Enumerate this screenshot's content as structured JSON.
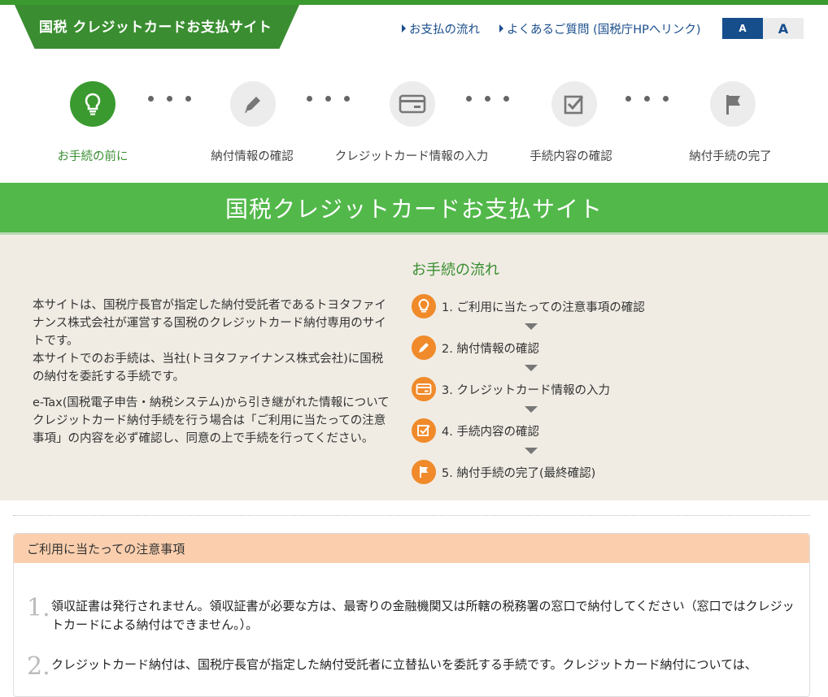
{
  "header": {
    "logo_text": "国税 クレジットカードお支払サイト",
    "links": [
      "お支払の流れ",
      "よくあるご質問 (国税庁HPへリンク)"
    ],
    "font_small": "A",
    "font_large": "A"
  },
  "steps": [
    {
      "label": "お手続の前に",
      "icon": "lightbulb-icon",
      "active": true
    },
    {
      "label": "納付情報の確認",
      "icon": "pencil-icon",
      "active": false
    },
    {
      "label": "クレジットカード情報の入力",
      "icon": "credit-card-icon",
      "active": false
    },
    {
      "label": "手続内容の確認",
      "icon": "checkbox-icon",
      "active": false
    },
    {
      "label": "納付手続の完了",
      "icon": "flag-icon",
      "active": false
    }
  ],
  "banner_title": "国税クレジットカードお支払サイト",
  "intro": {
    "paragraph1_line1": "本サイトは、国税庁長官が指定した納付受託者であるトヨタファイナンス株式会社が運営する国税のクレジットカード納付専用のサイトです。",
    "paragraph1_line2": "本サイトでのお手続は、当社(トヨタファイナンス株式会社)に国税の納付を委託する手続です。",
    "paragraph2": "e-Tax(国税電子申告・納税システム)から引き継がれた情報についてクレジットカード納付手続を行う場合は「ご利用に当たっての注意事項」の内容を必ず確認し、同意の上で手続を行ってください。"
  },
  "flow": {
    "title": "お手続の流れ",
    "items": [
      "1. ご利用に当たっての注意事項の確認",
      "2. 納付情報の確認",
      "3. クレジットカード情報の入力",
      "4. 手続内容の確認",
      "5. 納付手続の完了(最終確認)"
    ]
  },
  "notice": {
    "title": "ご利用に当たっての注意事項",
    "items": [
      {
        "num": "1.",
        "text": "領収証書は発行されません。領収証書が必要な方は、最寄りの金融機関又は所轄の税務署の窓口で納付してください（窓口ではクレジットカードによる納付はできません。）。"
      },
      {
        "num": "2.",
        "text": "クレジットカード納付は、国税庁長官が指定した納付受託者に立替払いを委託する手続です。クレジットカード納付については、"
      }
    ]
  },
  "colors": {
    "green": "#3a9a2f",
    "banner": "#52b84a",
    "orange": "#f08a2a",
    "navy": "#164e8c",
    "notice_header": "#fbcfae"
  }
}
